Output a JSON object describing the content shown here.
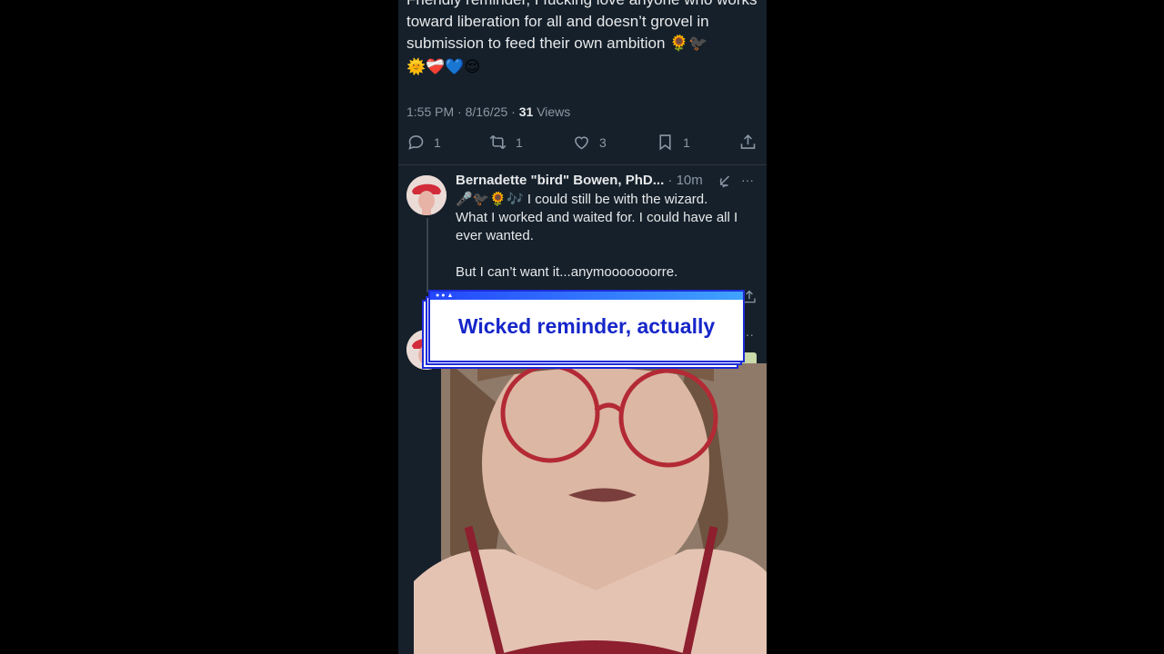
{
  "tweet": {
    "text": "Friendly reminder, I fucking love anyone who works toward liberation for all and doesn’t grovel in submission to feed their own ambition 🌻🐦‍⬛",
    "emoji_line": "🌞❤️‍🩹💙😌",
    "time": "1:55 PM · 8/16/25 ·",
    "views_count": "31",
    "views_label": "Views",
    "replies": "1",
    "retweets": "1",
    "likes": "3",
    "bookmarks": "1"
  },
  "reply": {
    "author": "Bernadette \"bird\" Bowen, PhD...",
    "time": "· 10m",
    "text": "🎤🐦‍⬛🌻🎶 I could still be with the wizard.\nWhat I worked and waited for. I could have all I ever wanted.\n\nBut I can’t want it...anymooooooorre."
  },
  "caption": {
    "text": "Wicked reminder, actually"
  },
  "icons": [
    "reply-icon",
    "retweet-icon",
    "like-icon",
    "bookmark-icon",
    "share-icon",
    "grok-icon",
    "more-icon"
  ]
}
